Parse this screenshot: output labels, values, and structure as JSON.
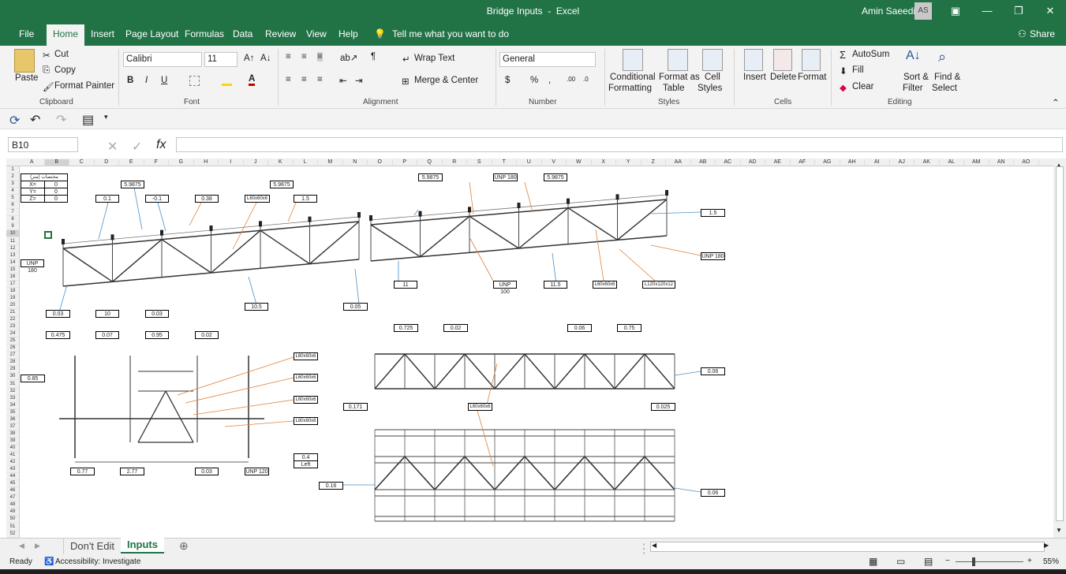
{
  "window": {
    "title": "Bridge Inputs",
    "app": "Excel",
    "title_sep": "-",
    "user": "Amin Saeedi",
    "initials": "AS"
  },
  "tabs": [
    {
      "label": "File"
    },
    {
      "label": "Home"
    },
    {
      "label": "Insert"
    },
    {
      "label": "Page Layout"
    },
    {
      "label": "Formulas"
    },
    {
      "label": "Data"
    },
    {
      "label": "Review"
    },
    {
      "label": "View"
    },
    {
      "label": "Help"
    }
  ],
  "tell_me": "Tell me what you want to do",
  "share": "Share",
  "clipboard": {
    "paste": "Paste",
    "cut": "Cut",
    "copy": "Copy",
    "format_painter": "Format Painter",
    "label": "Clipboard"
  },
  "font": {
    "name": "Calibri",
    "size": "11",
    "label": "Font"
  },
  "alignment": {
    "wrap": "Wrap Text",
    "merge": "Merge & Center",
    "label": "Alignment"
  },
  "number": {
    "format": "General",
    "label": "Number",
    "currency": "$",
    "percent": "%",
    "comma": ","
  },
  "styles": {
    "conditional": "Conditional",
    "formatting": "Formatting",
    "format_as": "Format as",
    "table": "Table",
    "cell": "Cell",
    "cell_styles": "Styles",
    "label": "Styles"
  },
  "cells": {
    "insert": "Insert",
    "delete": "Delete",
    "format": "Format",
    "label": "Cells"
  },
  "editing": {
    "autosum": "AutoSum",
    "fill": "Fill",
    "clear": "Clear",
    "sort": "Sort &",
    "filter": "Filter",
    "find": "Find &",
    "select": "Select",
    "label": "Editing"
  },
  "name_box": "B10",
  "columns": [
    "A",
    "B",
    "C",
    "D",
    "E",
    "F",
    "G",
    "H",
    "I",
    "J",
    "K",
    "L",
    "M",
    "N",
    "O",
    "P",
    "Q",
    "R",
    "S",
    "T",
    "U",
    "V",
    "W",
    "X",
    "Y",
    "Z",
    "AA",
    "AB",
    "AC",
    "AD",
    "AE",
    "AF",
    "AG",
    "AH",
    "AI",
    "AJ",
    "AK",
    "AL",
    "AM",
    "AN",
    "AO"
  ],
  "table": {
    "header": "مختصات (متر)",
    "rows": [
      [
        "X=",
        "0"
      ],
      [
        "Y=",
        "0"
      ],
      [
        "Z=",
        "0"
      ]
    ]
  },
  "labels": [
    {
      "t": "5.9875"
    },
    {
      "t": "5.9875"
    },
    {
      "t": "5.9875"
    },
    {
      "t": "UNP 180"
    },
    {
      "t": "5.9875"
    },
    {
      "t": "0.1"
    },
    {
      "t": "-0.1"
    },
    {
      "t": "0.38"
    },
    {
      "t": "L60x60x6"
    },
    {
      "t": "1.5"
    },
    {
      "t": "1.5"
    },
    {
      "t": "UNP 180"
    },
    {
      "t": "UNP 180"
    },
    {
      "t": "11"
    },
    {
      "t": "UNP 100"
    },
    {
      "t": "11.5"
    },
    {
      "t": "L60x60x6"
    },
    {
      "t": "L120x120x12"
    },
    {
      "t": "0.03"
    },
    {
      "t": "10"
    },
    {
      "t": "0.03"
    },
    {
      "t": "10.5"
    },
    {
      "t": "0.05"
    },
    {
      "t": "0.475"
    },
    {
      "t": "0.07"
    },
    {
      "t": "0.95"
    },
    {
      "t": "0.02"
    },
    {
      "t": "L60x60x6"
    },
    {
      "t": "L60x60x6"
    },
    {
      "t": "L60x60x6"
    },
    {
      "t": "L80x80x8"
    },
    {
      "t": "0.85"
    },
    {
      "t": "0.4"
    },
    {
      "t": "Left"
    },
    {
      "t": "0.77"
    },
    {
      "t": "2.77"
    },
    {
      "t": "0.03"
    },
    {
      "t": "UNP 120"
    },
    {
      "t": "0.725"
    },
    {
      "t": "0.02"
    },
    {
      "t": "0.06"
    },
    {
      "t": "0.75"
    },
    {
      "t": "0.06"
    },
    {
      "t": "0.171"
    },
    {
      "t": "L60x60x6"
    },
    {
      "t": "0.025"
    },
    {
      "t": "0.16"
    },
    {
      "t": "0.06"
    }
  ],
  "sheets": [
    {
      "label": "Don't Edit"
    },
    {
      "label": "Inputs"
    }
  ],
  "status": {
    "ready": "Ready",
    "accessibility": "Accessibility: Investigate",
    "zoom": "55%"
  }
}
